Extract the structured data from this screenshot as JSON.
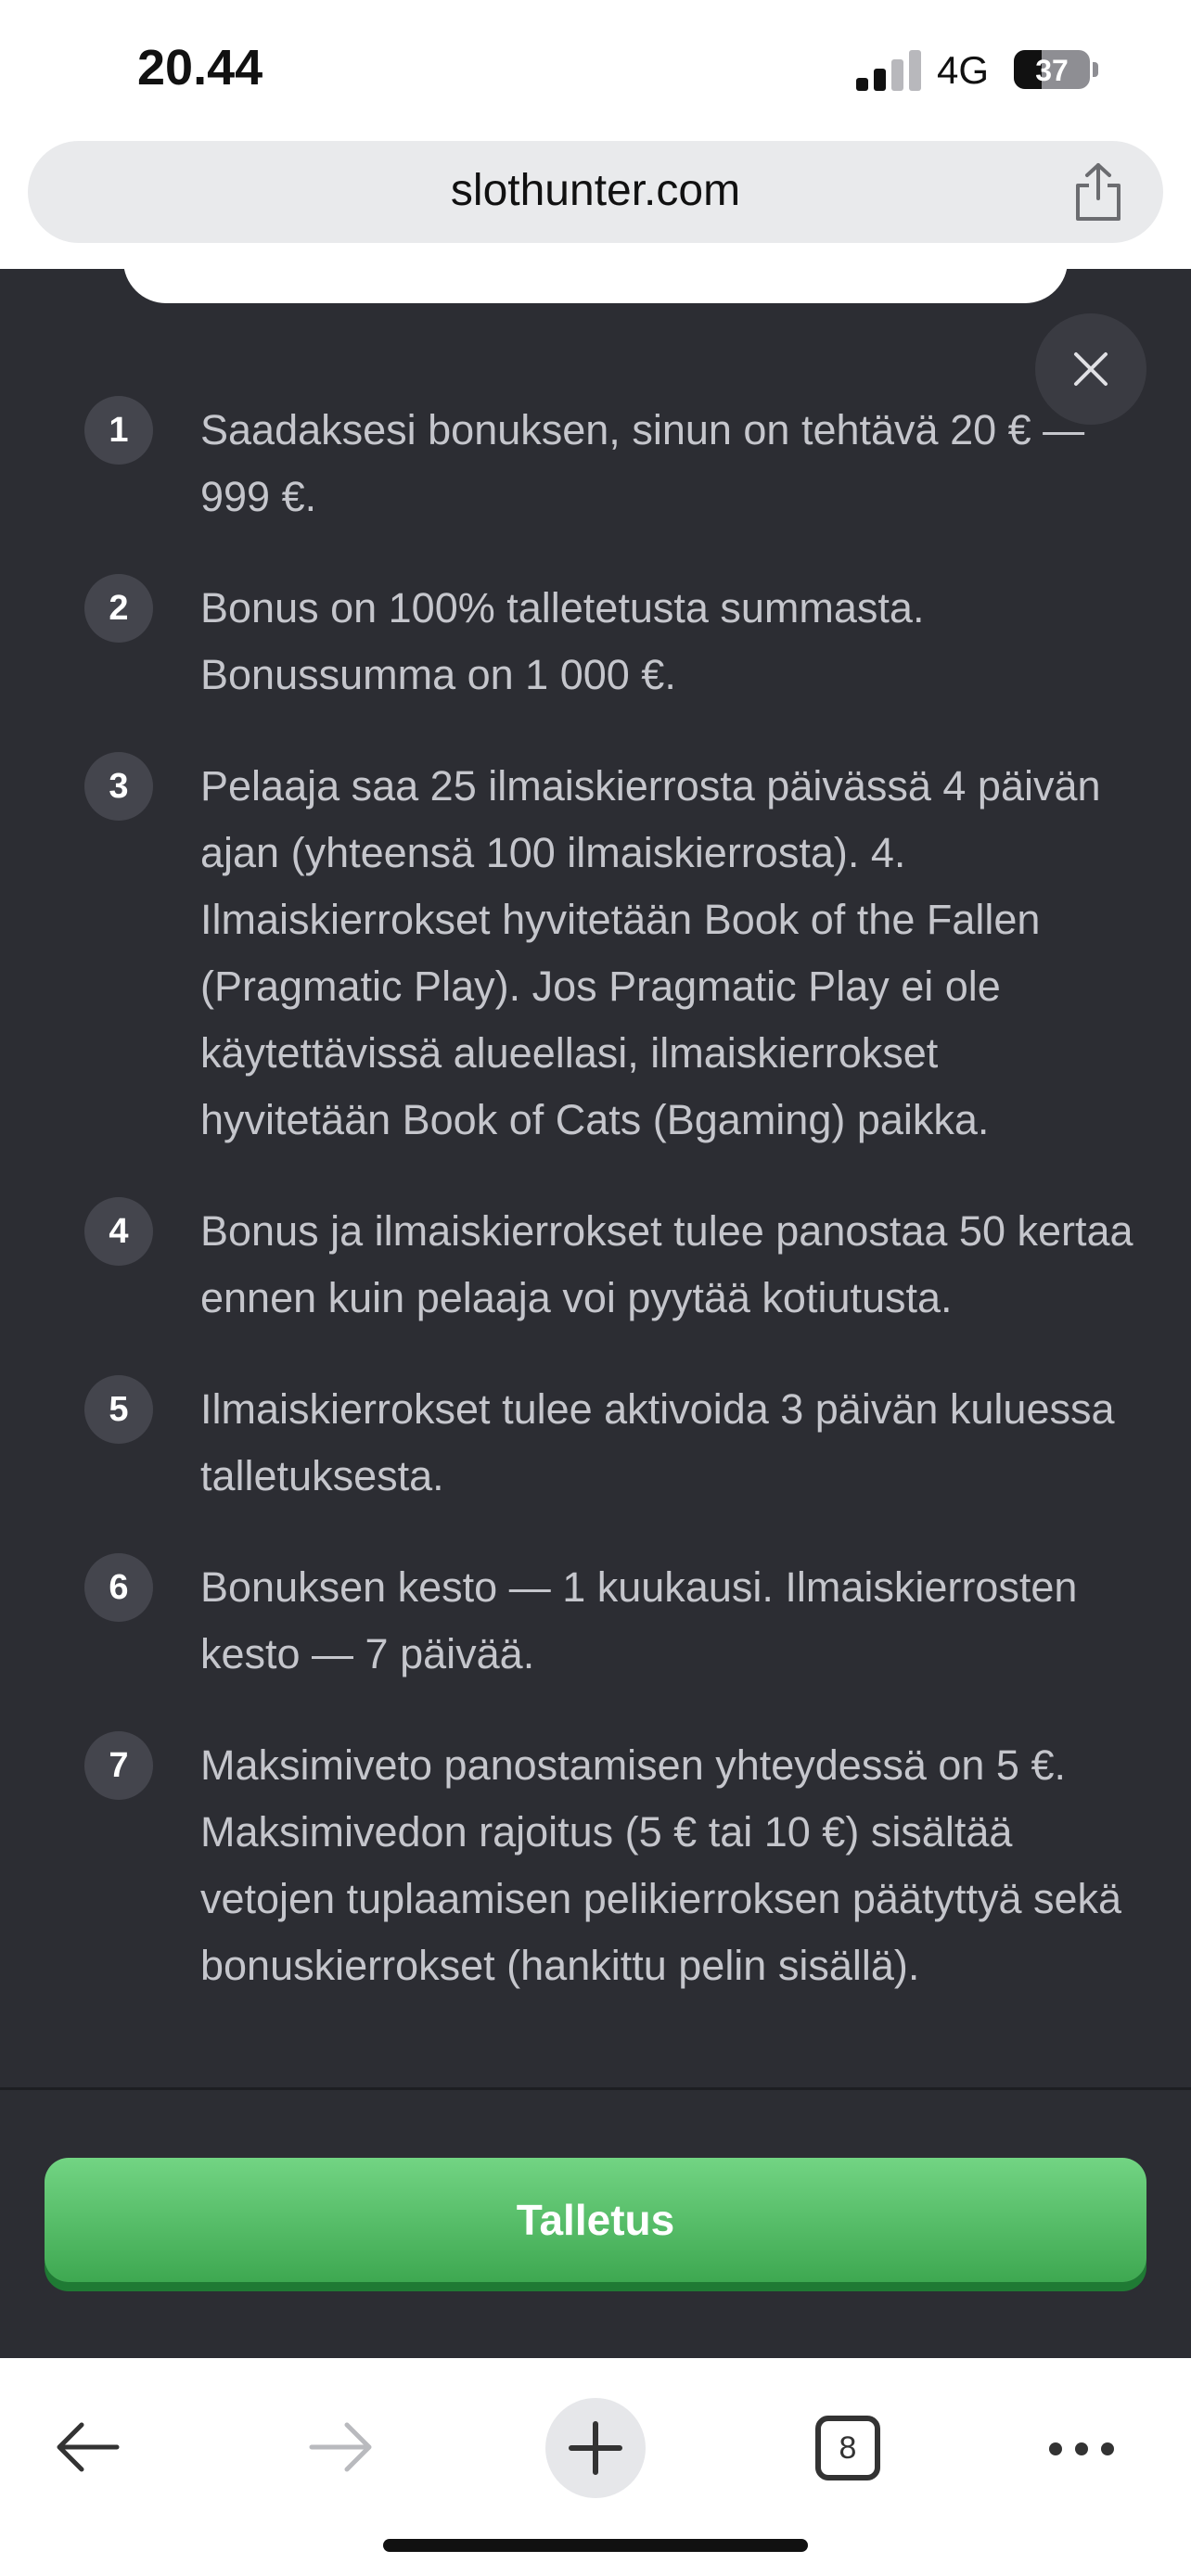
{
  "status": {
    "time": "20.44",
    "network": "4G",
    "battery_level": "37",
    "battery_fraction": 0.37,
    "signal_bars_active": 2,
    "signal_bars_total": 4
  },
  "browser": {
    "url": "slothunter.com",
    "share_icon": "share-icon"
  },
  "modal": {
    "close_icon": "close-icon",
    "rules": [
      {
        "number": "1",
        "text": "Saadaksesi bonuksen, sinun on tehtävä 20 € — 999 €."
      },
      {
        "number": "2",
        "text": "Bonus on 100% talletetusta summasta. Bonussumma on 1 000 €."
      },
      {
        "number": "3",
        "text": "Pelaaja saa 25 ilmaiskierrosta päivässä 4 päivän ajan (yhteensä 100 ilmaiskierrosta). 4. Ilmaiskierrokset hyvitetään Book of the Fallen (Pragmatic Play). Jos Pragmatic Play ei ole käytettävissä alueellasi, ilmaiskierrokset hyvitetään Book of Cats (Bgaming) paikka."
      },
      {
        "number": "4",
        "text": "Bonus ja ilmaiskierrokset tulee panostaa 50 kertaa ennen kuin pelaaja voi pyytää kotiutusta."
      },
      {
        "number": "5",
        "text": "Ilmaiskierrokset tulee aktivoida 3 päivän kuluessa talletuksesta."
      },
      {
        "number": "6",
        "text": "Bonuksen kesto — 1 kuukausi. Ilmaiskierrosten kesto — 7 päivää."
      },
      {
        "number": "7",
        "text": "Maksimiveto panostamisen yhteydessä on 5 €. Maksimivedon rajoitus (5 € tai 10 €) sisältää vetojen tuplaamisen pelikierroksen päätyttyä sekä bonuskierrokset (hankittu pelin sisällä)."
      }
    ],
    "deposit_button": "Talletus"
  },
  "toolbar": {
    "back_icon": "back-arrow-icon",
    "forward_icon": "forward-arrow-icon",
    "new_tab_icon": "plus-icon",
    "tab_count": "8",
    "more_icon": "more-dots-icon"
  },
  "colors": {
    "panel_bg": "#2c2d33",
    "text": "#c5c6cc",
    "number_bg": "#44454d",
    "button_green": "#4cb860"
  }
}
